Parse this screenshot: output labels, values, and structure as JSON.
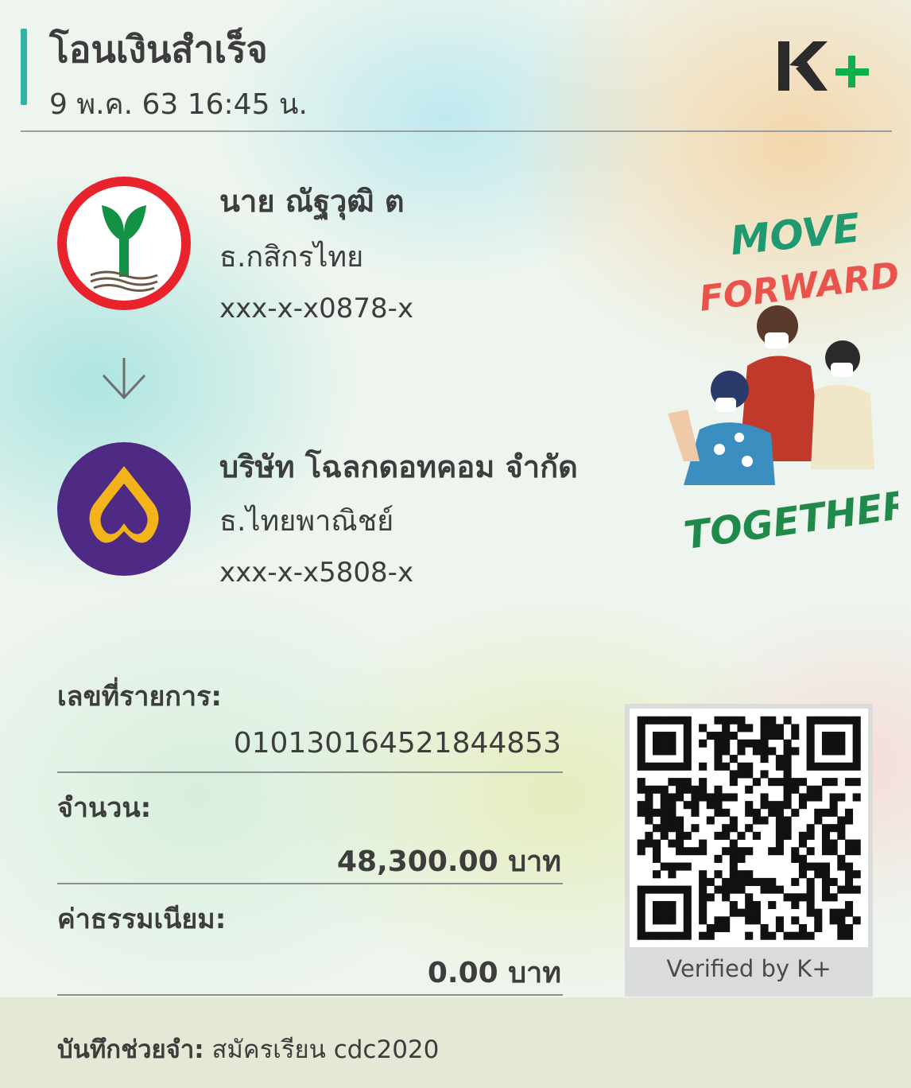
{
  "header": {
    "title": "โอนเงินสำเร็จ",
    "datetime": "9 พ.ค. 63  16:45 น.",
    "brand": "K+"
  },
  "sender": {
    "name": "นาย ณัฐวุฒิ ต",
    "bank": "ธ.กสิกรไทย",
    "account": "xxx-x-x0878-x"
  },
  "receiver": {
    "name": "บริษัท โฉลกดอทคอม จำกัด",
    "bank": "ธ.ไทยพาณิชย์",
    "account": "xxx-x-x5808-x"
  },
  "promo": {
    "line1": "MOVE",
    "line2": "FORWARD",
    "line3": "TOGETHER"
  },
  "details": {
    "ref_label": "เลขที่รายการ:",
    "ref_value": "010130164521844853",
    "amount_label": "จำนวน:",
    "amount_value": "48,300.00 บาท",
    "fee_label": "ค่าธรรมเนียม:",
    "fee_value": "0.00 บาท"
  },
  "qr": {
    "caption": "Verified by K+"
  },
  "memo": {
    "label": "บันทึกช่วยจำ:",
    "value": "สมัครเรียน cdc2020"
  },
  "colors": {
    "accent": "#2fb3a9",
    "kbank_red": "#e8232b",
    "kbank_green": "#139245",
    "scb_purple": "#4e2a84",
    "scb_gold": "#f2b31b",
    "kplus_green": "#0cb04b"
  },
  "icons": [
    "kbank-logo-icon",
    "scb-logo-icon",
    "arrow-down-icon",
    "qr-code-icon",
    "kplus-logo-icon"
  ]
}
